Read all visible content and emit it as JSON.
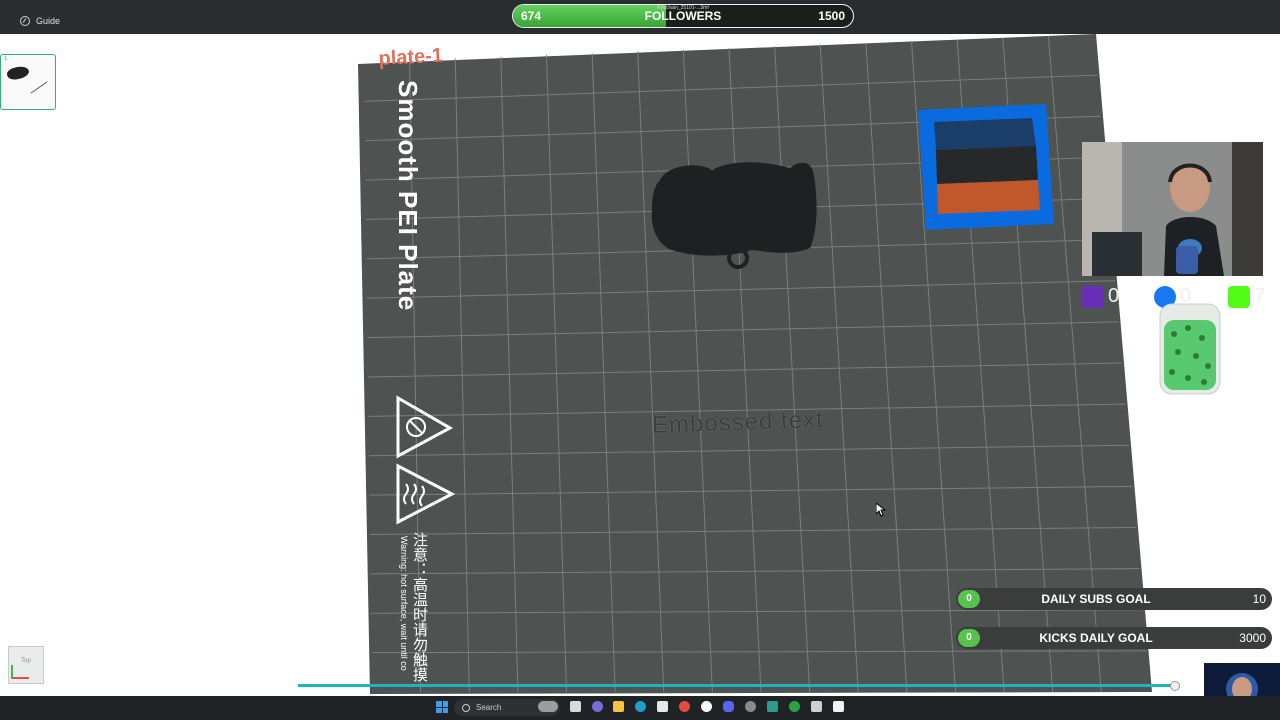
{
  "window": {
    "guide_label": "Guide"
  },
  "followers": {
    "current": 674,
    "label": "FOLLOWERS",
    "goal": 1500,
    "tiny_caption": "Keychain_25101-...3mf"
  },
  "plates": [
    {
      "number": "1"
    }
  ],
  "viewcube": {
    "label": "Top"
  },
  "scene": {
    "plate_label": "plate-1",
    "plate_name": "Smooth PEI Plate",
    "warning_cn": "注意：高温时请勿触摸",
    "warning_en": "Warning: hot surface, wait until co",
    "embossed_text": "Embossed text"
  },
  "social": {
    "twitch_count": "0",
    "facebook_count": "0",
    "kick_count": "7"
  },
  "goals": [
    {
      "current": "0",
      "label": "DAILY SUBS GOAL",
      "target": "10",
      "progress": 0
    },
    {
      "current": "0",
      "label": "KICKS DAILY GOAL",
      "target": "3000",
      "progress": 0
    }
  ],
  "taskbar": {
    "search_placeholder": "Search"
  },
  "colors": {
    "bed": "#4e5251",
    "grid": "#7a7f7e",
    "accent": "#e07060",
    "progress": "#1bb5c0",
    "goal_green": "#57c34f"
  }
}
